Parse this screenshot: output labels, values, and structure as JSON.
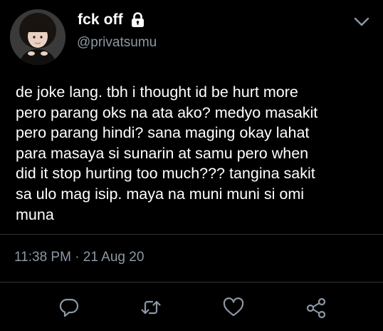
{
  "tweet": {
    "display_name": "fck off",
    "handle": "@privatsumu",
    "body_lines": [
      "de joke lang. tbh i thought id be hurt more",
      "pero parang oks na ata ako? medyo masakit",
      "pero parang hindi? sana maging okay lahat",
      "para masaya si sunarin at samu pero when",
      "did it stop hurting too much??? tangina sakit",
      "sa ulo mag isip. maya na muni muni si omi",
      "muna"
    ],
    "timestamp": "11:38 PM · 21 Aug 20"
  },
  "icons": {
    "avatar": "profile-photo",
    "lock": "lock-icon",
    "menu": "chevron-down-icon",
    "reply": "reply-icon",
    "retweet": "retweet-icon",
    "like": "heart-icon",
    "share": "share-icon"
  },
  "colors": {
    "background": "#000000",
    "text": "#ffffff",
    "secondary_text": "#8b98a5",
    "divider": "#2f3336"
  }
}
